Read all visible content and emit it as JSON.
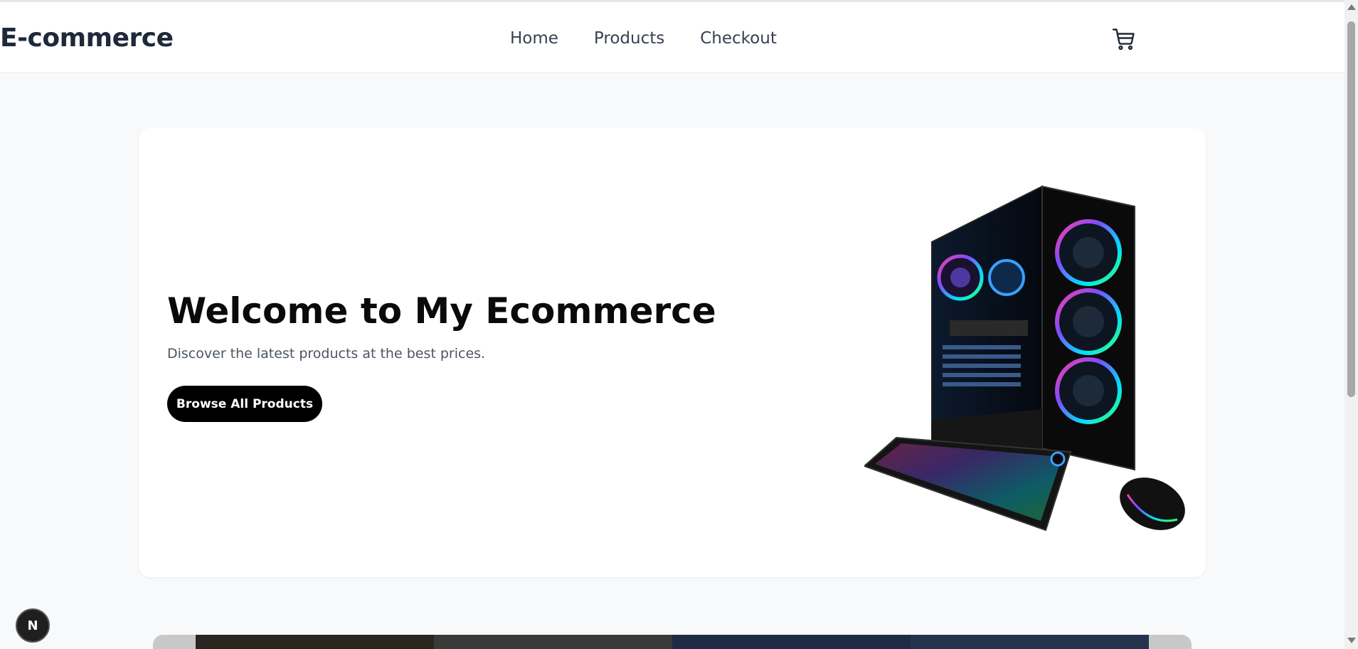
{
  "header": {
    "brand": "E-commerce",
    "nav": [
      {
        "label": "Home"
      },
      {
        "label": "Products"
      },
      {
        "label": "Checkout"
      }
    ],
    "cart_icon": "cart-icon"
  },
  "hero": {
    "title": "Welcome to My Ecommerce",
    "subtitle": "Discover the latest products at the best prices.",
    "button_label": "Browse All Products",
    "image_icon": "gaming-pc-image"
  },
  "badge": {
    "letter": "N"
  },
  "colors": {
    "page_bg": "#f8f9fa",
    "header_bg": "#ffffff",
    "brand_text": "#1e293b",
    "button_bg": "#000000",
    "button_text": "#ffffff"
  }
}
